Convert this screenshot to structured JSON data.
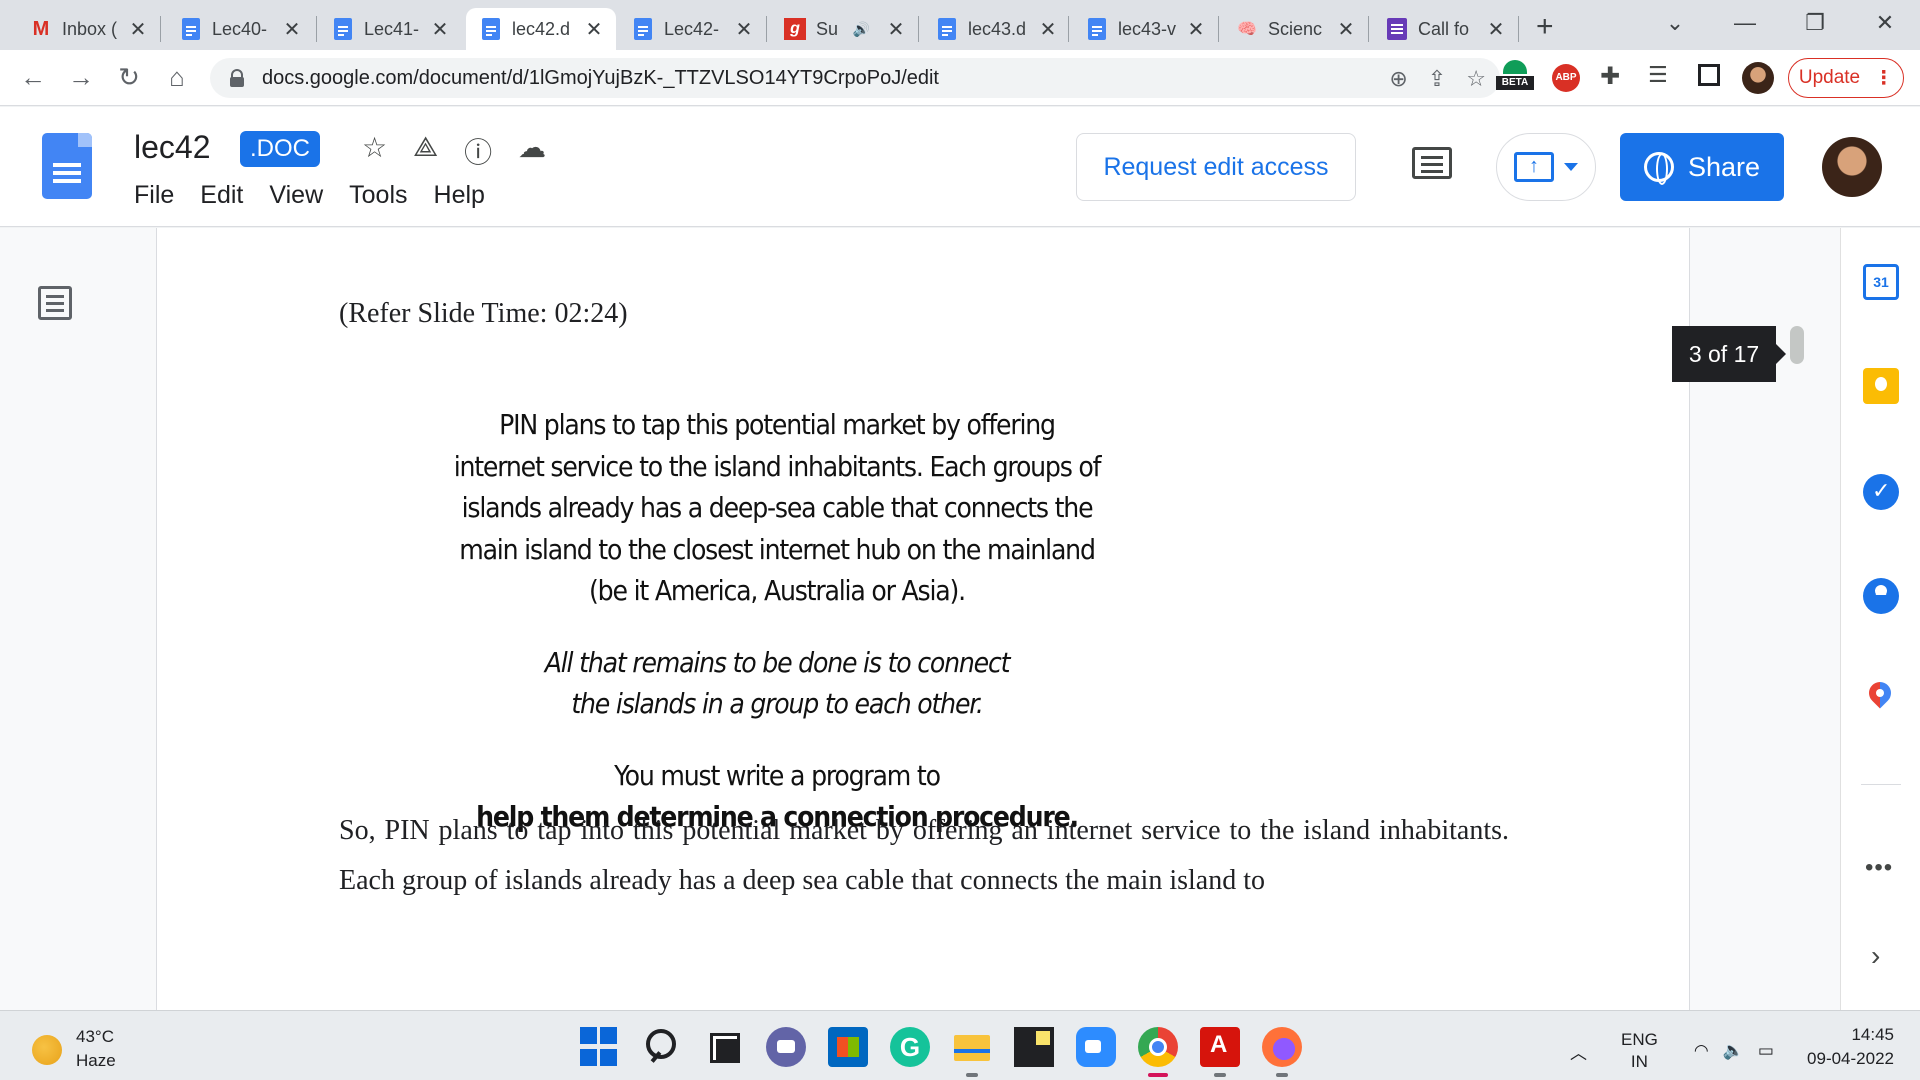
{
  "browser": {
    "tabs": [
      {
        "title": "Inbox (",
        "icon": "gmail-icon",
        "active": false
      },
      {
        "title": "Lec40-",
        "icon": "docs-icon",
        "active": false
      },
      {
        "title": "Lec41-",
        "icon": "docs-icon",
        "active": false
      },
      {
        "title": "lec42.d",
        "icon": "docs-icon",
        "active": true
      },
      {
        "title": "Lec42-",
        "icon": "docs-icon",
        "active": false
      },
      {
        "title": "Su",
        "icon": "g-icon",
        "active": false
      },
      {
        "title": "lec43.d",
        "icon": "docs-icon",
        "active": false
      },
      {
        "title": "lec43-v",
        "icon": "docs-icon",
        "active": false
      },
      {
        "title": "Scienc",
        "icon": "brain-icon",
        "active": false
      },
      {
        "title": "Call fo",
        "icon": "forms-icon",
        "active": false
      }
    ],
    "tab_close": "✕",
    "new_tab": "+",
    "url": "docs.google.com/document/d/1lGmojYujBzK-_TTZVLSO14YT9CrpoPoJ/edit",
    "extension_beta": "BETA",
    "extension_abp": "ABP",
    "update_label": "Update"
  },
  "doc": {
    "title": "lec42",
    "badge": ".DOC",
    "menu": [
      "File",
      "Edit",
      "View",
      "Tools",
      "Help"
    ],
    "request_edit_label": "Request edit access",
    "share_label": "Share",
    "refer_text": "(Refer Slide Time: 02:24)",
    "slide": {
      "p1_lines": [
        "PIN plans to tap this potential market by offering",
        "internet service to the island inhabitants. Each groups of",
        "islands already has a deep-sea cable that connects the",
        "main island to the closest internet hub on the mainland",
        "(be it America, Australia or Asia)."
      ],
      "p2_lines": [
        "All that remains to be done is to connect",
        "the islands in a group to each other."
      ],
      "p3_line1": "You must write a program to",
      "p3_line2": "help them determine a connection procedure."
    },
    "body_text": "So, PIN plans to tap into this potential market by offering an internet service to the island inhabitants. Each group of islands already has a deep sea cable that connects the main island to",
    "page_indicator": "3 of 17"
  },
  "side_panel": {
    "calendar_day": "31",
    "more": "•••",
    "chevron": "›"
  },
  "taskbar": {
    "temperature": "43°C",
    "condition": "Haze",
    "lang_line1": "ENG",
    "lang_line2": "IN",
    "time": "14:45",
    "date": "09-04-2022"
  }
}
